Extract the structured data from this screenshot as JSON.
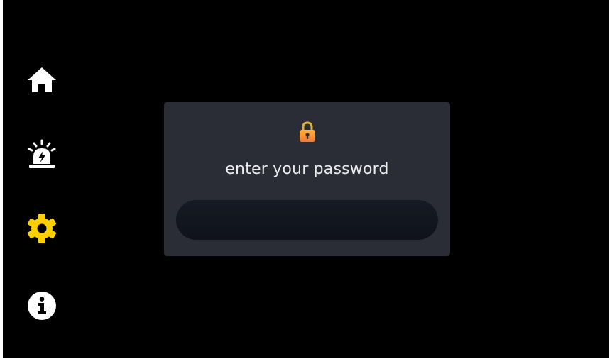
{
  "nav": {
    "items": [
      {
        "icon": "home-icon",
        "color": "#ffffff",
        "active": false
      },
      {
        "icon": "alarm-icon",
        "color": "#ffffff",
        "active": false
      },
      {
        "icon": "gear-icon",
        "color": "#ffd000",
        "active": true
      },
      {
        "icon": "info-icon",
        "color": "#ffffff",
        "active": false
      }
    ]
  },
  "dialog": {
    "icon": "lock-icon",
    "prompt": "enter your password",
    "password_value": "",
    "password_placeholder": ""
  },
  "colors": {
    "background": "#000000",
    "dialog": "#2b2d36",
    "accent": "#ffd000",
    "text": "#ececf0"
  }
}
